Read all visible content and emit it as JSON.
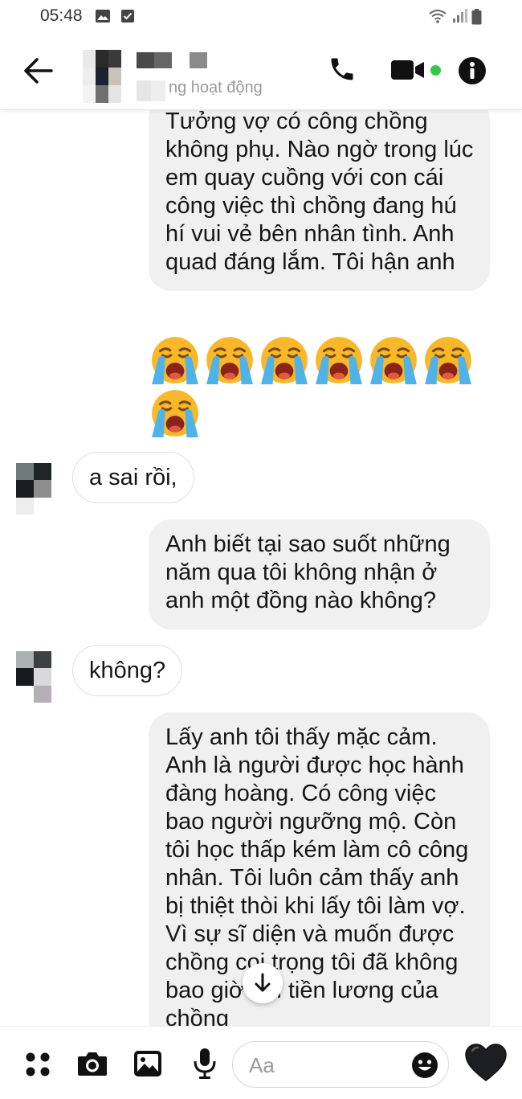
{
  "status_bar": {
    "time": "05:48"
  },
  "header": {
    "status": "ng hoạt động"
  },
  "messages": [
    {
      "dir": "out",
      "text": "Tưởng vợ có công chồng không phụ. Nào ngờ trong lúc em quay cuồng với con cái công việc thì chồng đang hú hí vui vẻ bên nhân tình. Anh quad đáng lắm. Tôi hận anh"
    },
    {
      "dir": "out",
      "emoji": "loudly-crying-face",
      "count": 7
    },
    {
      "dir": "in",
      "text": "a sai rồi,"
    },
    {
      "dir": "out",
      "text": "Anh biết tại sao suốt những năm qua tôi không nhận ở anh một đồng nào không?"
    },
    {
      "dir": "in",
      "text": "không?"
    },
    {
      "dir": "out",
      "text": "Lấy anh tôi thấy mặc cảm. Anh là người được học hành đàng hoàng. Có công việc bao người ngưỡng mộ. Còn tôi học thấp kém làm cô công nhân. Tôi luôn cảm thấy anh bị thiệt thòi khi lấy tôi làm vợ. Vì sự sĩ diện và muốn được chồng coi trọng tôi đã không bao giờ hỏi tiền lương của chồng"
    }
  ],
  "composer": {
    "placeholder": "Aa"
  },
  "colors": {
    "online": "#31cc46",
    "bubble_out": "#f1f0f0",
    "heart": "#1c1e21"
  },
  "icons": [
    "back-arrow-icon",
    "phone-icon",
    "video-camera-icon",
    "info-icon",
    "apps-icon",
    "camera-icon",
    "gallery-icon",
    "microphone-icon",
    "smiley-icon",
    "heart-icon",
    "arrow-down-icon"
  ]
}
